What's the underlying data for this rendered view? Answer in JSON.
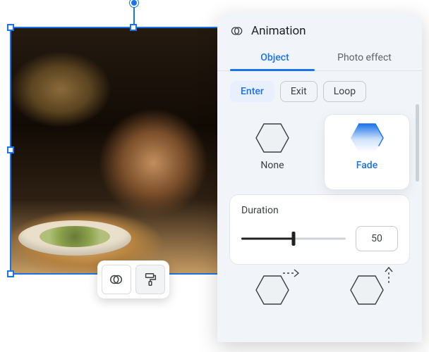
{
  "selection_color": "#1a73e8",
  "panel": {
    "title": "Animation",
    "tabs": {
      "object": "Object",
      "photo_effect": "Photo effect",
      "active": "object"
    },
    "phases": {
      "enter": "Enter",
      "exit": "Exit",
      "loop": "Loop",
      "selected": "enter"
    },
    "presets": {
      "none": "None",
      "fade": "Fade",
      "selected": "fade"
    },
    "duration": {
      "label": "Duration",
      "value": "50",
      "percent": 50
    }
  }
}
